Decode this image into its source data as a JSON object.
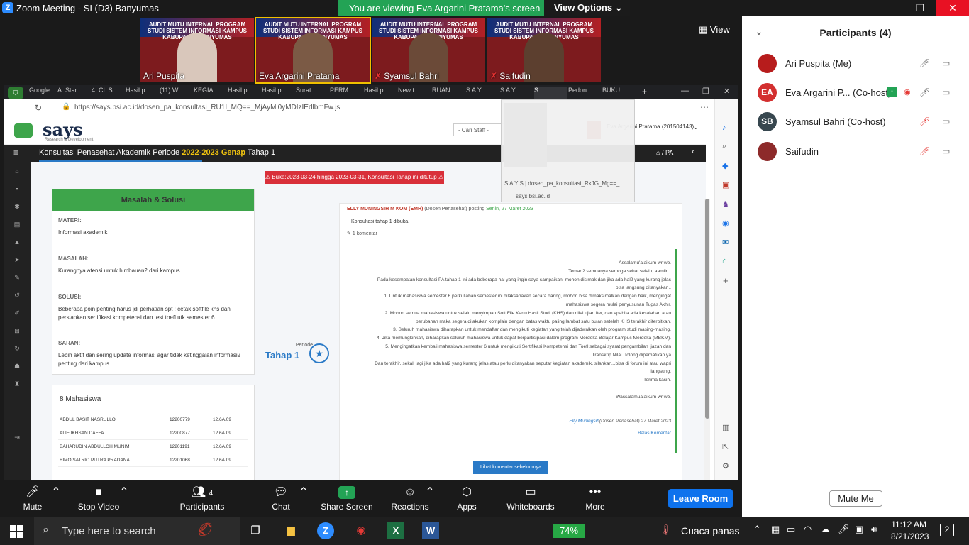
{
  "window": {
    "title": "Zoom Meeting - SI (D3) Banyumas"
  },
  "banner": {
    "message": "You are viewing Eva Argarini Pratama's screen",
    "view_options": "View Options"
  },
  "gallery": {
    "view_label": "View",
    "header_text": "AUDIT MUTU INTERNAL PROGRAM STUDI SISTEM INFORMASI KAMPUS KABUPATEN BANYUMAS",
    "tiles": [
      {
        "name": "Ari Puspita"
      },
      {
        "name": "Eva Argarini Pratama"
      },
      {
        "name": "Syamsul Bahri"
      },
      {
        "name": "Saifudin"
      }
    ]
  },
  "browser": {
    "tabs": [
      "Google",
      "A. Star",
      "4. CL S",
      "Hasil p",
      "(11) W",
      "KEGIA",
      "Hasil p",
      "Hasil p",
      "Surat",
      "PERM",
      "Hasil p",
      "New t",
      "RUAN",
      "S A Y",
      "S A Y",
      "S",
      "Pedon",
      "BUKU"
    ],
    "url": "https://says.bsi.ac.id/dosen_pa_konsultasi_RU1I_MQ==_MjAyMi0yMDIzIEdlbmFw.js",
    "popup": {
      "title": "S A Y S | dosen_pa_konsultasi_RkJG_Mg==_",
      "domain": "says.bsi.ac.id"
    }
  },
  "site": {
    "logo": "says",
    "logo_sub": "Research & Development",
    "staff_placeholder": "- Cari Staff -",
    "user": "Eva Argarini Pratama (201504143)",
    "nav": {
      "prefix": "Konsultasi Penasehat Akademik Periode ",
      "year": "2022-2023 Genap",
      "suffix": " Tahap 1",
      "crumb": "PA"
    },
    "alert": "Buka:2023-03-24 hingga 2023-03-31, Konsultasi Tahap ini ditutup",
    "problem": {
      "title": "Masalah & Solusi",
      "materi_h": "MATERI:",
      "materi": "Informasi akademik",
      "masalah_h": "MASALAH:",
      "masalah": "Kurangnya atensi untuk himbauan2 dari kampus",
      "solusi_h": "SOLUSI:",
      "solusi": "Beberapa poin penting harus jdi perhatian spt : cetak softfile khs dan persiapkan sertifikasi kompetensi dan test toefl utk semester 6",
      "saran_h": "SARAN:",
      "saran": "Lebih aktif dan sering update informasi agar tidak ketinggalan informasi2 penting dari kampus"
    },
    "periode_label": "Periode",
    "tahap_label": "Tahap 1",
    "post": {
      "author": "ELLY MUNINGSIH M KOM (EMH)",
      "role": " (Dosen Penasehat) posting ",
      "date": "Senin, 27 Maret 2023",
      "message": "Konsultasi tahap 1 dibuka.",
      "comment_count": "1 komentar",
      "comment_lines": [
        "Assalamu'alaikum wr wb.",
        "Teman2 semuanya semoga sehat selalu, aamiin..",
        "Pada kesempatan konsultasi PA tahap 1 ini ada beberapa hal yang ingin saya sampaikan, mohon disimak dan jika ada hal2 yang kurang jelas",
        "bisa langsung ditanyakan..",
        "1. Untuk mahasiswa semester 6 perkuliahan semester ini dilaksanakan secara daring, mohon bisa dimaksimalkan dengan baik, mengingat",
        "mahasiswa segera mulai penyusunan Tugas Akhir.",
        "2. Mohon semua mahasiswa untuk selalu menyimpan Soft File Kartu Hasil Studi (KHS) dan nilai ujian iter, dan apabila ada kesalahan atau",
        "perubahan maka segera dilakukan komplain dengan batas waktu paling lambat satu bulan setelah KHS terakhir diterbitkan.",
        "3. Seluruh mahasiswa diharapkan untuk mendaftar dan mengikuti kegiatan yang telah dijadwalkan oleh program studi masing-masing.",
        "4. Jika memungkinkan, diharapkan seluruh mahasiswa untuk dapat berpartisipasi dalam program Merdeka Belajar Kampus Merdeka (MBKM).",
        "5. Mengingatkan kembali mahasiswa semester 6 untuk mengikuti Sertifikasi Kompetensi dan Toefl sebagai syarat pengambilan Ijazah dan",
        "Transkrip Nilai. Tolong diperhatikan ya",
        "Dan terakhir, sekali lagi jika ada hal2 yang kurang jelas atau perlu ditanyakan seputar kegiatan akademik, silahkan...bisa di forum ini atau wapri",
        "langsung.",
        "Terima kasih.",
        "",
        "Wassalamualaikum wr wb."
      ],
      "comment_sign": "Elly Muningsih",
      "comment_sign_role": "(Dosen Penasehat) 27 Maret 2023",
      "reply": "Balas Komentar",
      "prev_comments": "Lihat komentar sebelumnya"
    },
    "students": {
      "title": "8 Mahasiswa",
      "rows": [
        {
          "name": "ABDUL BASIT NASRULLOH",
          "nim": "12200779",
          "class": "12.6A.09"
        },
        {
          "name": "ALIF IKHSAN DAFFA",
          "nim": "12200877",
          "class": "12.6A.09"
        },
        {
          "name": "BAHARUDIN ABDULLOH MUNIM",
          "nim": "12201191",
          "class": "12.6A.09"
        },
        {
          "name": "BIMO SATRIO PUTRA PRADANA",
          "nim": "12201068",
          "class": "12.6A.09"
        }
      ]
    }
  },
  "toolbar": {
    "mute": "Mute",
    "stop_video": "Stop Video",
    "participants": "Participants",
    "participants_count": "4",
    "chat": "Chat",
    "share_screen": "Share Screen",
    "reactions": "Reactions",
    "apps": "Apps",
    "whiteboards": "Whiteboards",
    "more": "More",
    "leave": "Leave Room"
  },
  "participants_panel": {
    "title": "Participants (4)",
    "list": [
      {
        "initials": "",
        "name": "Ari Puspita (Me)"
      },
      {
        "initials": "EA",
        "name": "Eva Argarini P... (Co-host)"
      },
      {
        "initials": "SB",
        "name": "Syamsul Bahri (Co-host)"
      },
      {
        "initials": "",
        "name": "Saifudin"
      }
    ],
    "mute_me": "Mute Me"
  },
  "taskbar": {
    "search_placeholder": "Type here to search",
    "battery": "74%",
    "weather": "Cuaca panas",
    "time": "11:12 AM",
    "date": "8/21/2023",
    "notif_count": "2"
  },
  "colors": {
    "zoom_blue": "#0e72ed",
    "banner_green": "#23a355",
    "says_green": "#3ea54b",
    "alert_red": "#d9303a"
  }
}
